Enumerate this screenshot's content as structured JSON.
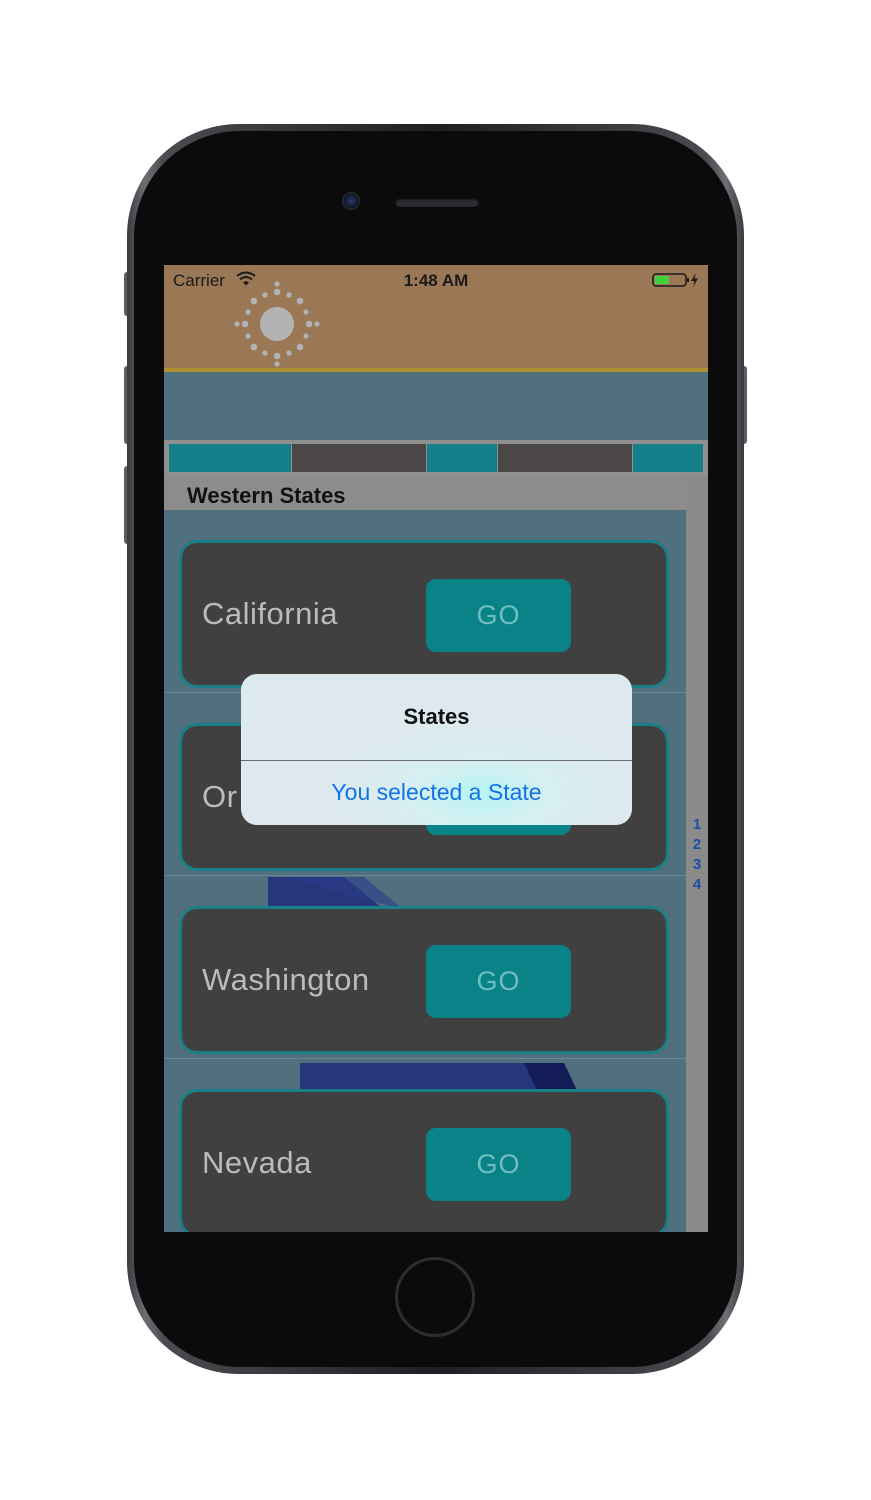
{
  "status_bar": {
    "carrier": "Carrier",
    "time": "1:48 AM"
  },
  "icons": {
    "wifi": "wifi-icon",
    "battery": "battery-charging-icon",
    "header_logo": "sun-icon"
  },
  "colors": {
    "header_bg": "#9b7855",
    "accent_teal": "#0a8388",
    "card_bg": "#404040",
    "segment_dark": "#4a4746",
    "alert_link": "#1273e6"
  },
  "section": {
    "title": "Western States"
  },
  "states": [
    {
      "name": "California",
      "button_label": "GO"
    },
    {
      "name": "Or",
      "button_label": "GO"
    },
    {
      "name": "Washington",
      "button_label": "GO"
    },
    {
      "name": "Nevada",
      "button_label": "GO"
    }
  ],
  "section_index": [
    "1",
    "2",
    "3",
    "4"
  ],
  "alert": {
    "title": "States",
    "action_label": "You selected a State"
  }
}
